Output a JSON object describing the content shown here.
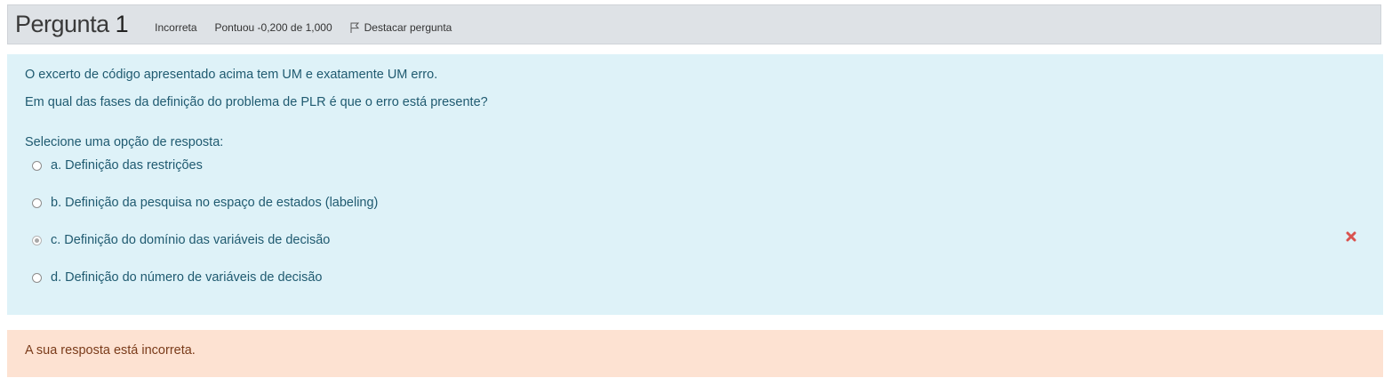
{
  "question": {
    "title": "Pergunta",
    "number": "1",
    "status": "Incorreta",
    "score": "Pontuou -0,200 de 1,000",
    "flag_label": "Destacar pergunta"
  },
  "qtext": {
    "line1": "O excerto de código apresentado acima tem UM e exatamente UM erro.",
    "line2": "Em qual das fases da definição do problema de PLR é que o erro está presente?"
  },
  "prompt": "Selecione uma opção de resposta:",
  "options": [
    {
      "label": "a. Definição das restrições",
      "selected": false
    },
    {
      "label": "b. Definição da pesquisa no espaço de estados (labeling)",
      "selected": false
    },
    {
      "label": "c. Definição do domínio das variáveis de decisão",
      "selected": true,
      "result": "incorrect"
    },
    {
      "label": "d. Definição do número de variáveis de decisão",
      "selected": false
    }
  ],
  "feedback": "A sua resposta está incorreta.",
  "colors": {
    "info_bg": "#dee2e6",
    "formulation_bg": "#def2f8",
    "feedback_bg": "#fde2d2",
    "wrong_icon": "#d9534f"
  },
  "icons": {
    "flag": "flag-icon",
    "wrong": "cross-icon"
  }
}
